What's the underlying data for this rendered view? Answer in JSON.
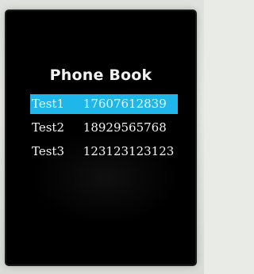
{
  "screen": {
    "title": "Phone Book"
  },
  "contacts": [
    {
      "name": "Test1",
      "number": "17607612839",
      "selected": true
    },
    {
      "name": "Test2",
      "number": "18929565768",
      "selected": false
    },
    {
      "name": "Test3",
      "number": "123123123123",
      "selected": false
    }
  ],
  "colors": {
    "background": "#000000",
    "selection_highlight": "#1fb7ea",
    "text": "#f5f5f5"
  }
}
